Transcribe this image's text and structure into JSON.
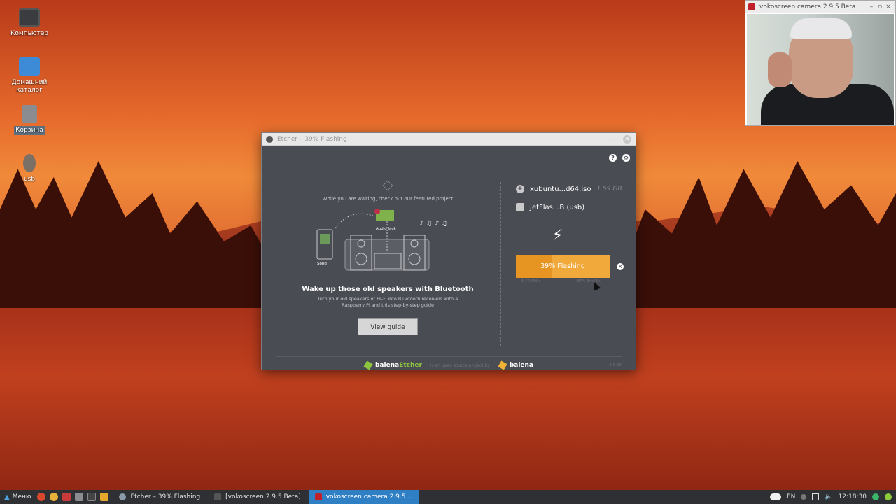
{
  "desktop": {
    "icons": [
      {
        "label": "Компьютер",
        "icon": "monitor-icon"
      },
      {
        "label": "Домашний каталог",
        "icon": "home-folder-icon"
      },
      {
        "label": "Корзина",
        "icon": "trash-icon"
      },
      {
        "label": "usb",
        "icon": "usb-drive-icon"
      }
    ]
  },
  "etcher": {
    "window_title": "Etcher – 39% Flashing",
    "featured": {
      "waiting_text": "While you are waiting, check out our featured project",
      "audio_jack_label": "Audio Jack",
      "song_label": "Song",
      "headline": "Wake up those old speakers with Bluetooth",
      "subtext": "Turn your old speakers or Hi-Fi into Bluetooth receivers with a Raspberry Pi and this step-by-step guide",
      "button_label": "View guide"
    },
    "image": {
      "name": "xubuntu...d64.iso",
      "size": "1.59 GB"
    },
    "drive": {
      "name": "JetFlas...B (usb)"
    },
    "progress": {
      "label": "39% Flashing",
      "percent": 39,
      "speed": "5.70 MB/s",
      "eta": "ETA: 3m06s"
    },
    "footer": {
      "brand_a": "balena",
      "brand_b": "Etcher",
      "middle": "is an open source project by",
      "brand_c": "balena",
      "version": "1.5.56"
    },
    "colors": {
      "accent": "#f2a93b",
      "bg": "#4a4c54",
      "green": "#8dc63f"
    }
  },
  "vokoscreen": {
    "window_title": "vokoscreen camera 2.9.5 Beta"
  },
  "taskbar": {
    "menu_label": "Меню",
    "tasks": [
      {
        "label": "Etcher – 39% Flashing",
        "active": false
      },
      {
        "label": "[vokoscreen 2.9.5 Beta]",
        "active": false
      },
      {
        "label": "vokoscreen camera 2.9.5 ...",
        "active": true
      }
    ],
    "lang": "EN",
    "clock": "12:18:30"
  }
}
